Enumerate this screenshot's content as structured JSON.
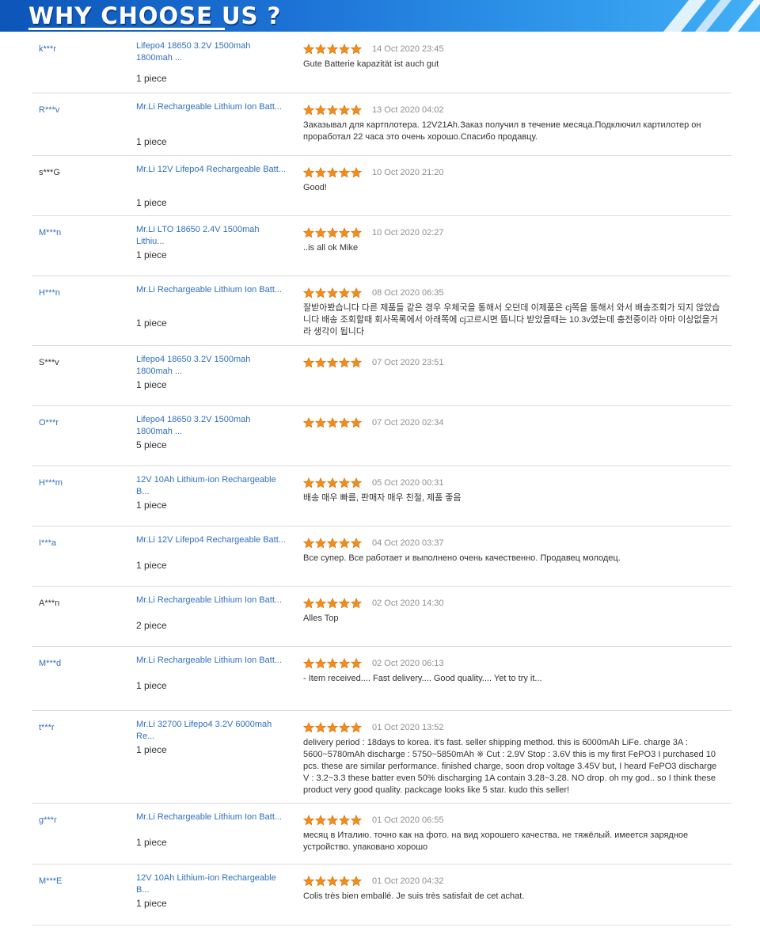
{
  "banner": {
    "title": "WHY CHOOSE US ?"
  },
  "colors": {
    "banner_blue": "#1d74d6",
    "link": "#2f6fbe",
    "star": "#f28c1c"
  },
  "star_icon": "star-icon",
  "reviews": [
    {
      "buyer": "k***r",
      "buyer_link": true,
      "product": "Lifepo4 18650 3.2V 1500mah 1800mah ...",
      "quantity": "1 piece",
      "rating": 5,
      "date": "14 Oct 2020 23:45",
      "comment": "Gute Batterie kapazität ist auch gut"
    },
    {
      "buyer": "R***v",
      "buyer_link": true,
      "product": "Mr.Li Rechargeable Lithium Ion Batt...",
      "quantity": "1 piece",
      "rating": 5,
      "date": "13 Oct 2020 04:02",
      "comment": "Заказывал для картплотера. 12V21Ah.Заказ получил в течение месяца.Подключил картилотер он проработал 22 часа это очень хорошо.Спасибо продавцу."
    },
    {
      "buyer": "s***G",
      "buyer_link": false,
      "product": "Mr.Li 12V Lifepo4 Rechargeable Batt...",
      "quantity": "1 piece",
      "rating": 5,
      "date": "10 Oct 2020 21:20",
      "comment": "Good!"
    },
    {
      "buyer": "M***n",
      "buyer_link": true,
      "product": "Mr.Li LTO 18650 2.4V 1500mah Lithiu...",
      "quantity": "1 piece",
      "rating": 5,
      "date": "10 Oct 2020 02:27",
      "comment": "..is all ok Mike"
    },
    {
      "buyer": "H***n",
      "buyer_link": true,
      "product": "Mr.Li Rechargeable Lithium Ion Batt...",
      "quantity": "1 piece",
      "rating": 5,
      "date": "08 Oct 2020 06:35",
      "comment": "잘받아봤습니다 다른 제품들 같은 경우 우체국을 통해서 오던데 이제품은 cj쪽을 통해서 와서 배송조회가 되지 않았습니다 배송 조회할때 회사목록에서 아래쪽에 cj고르시면 뜹니다 받았을때는 10.3v였는데 충전중이라 아마 이상없을거라 생각이 됩니다"
    },
    {
      "buyer": "S***v",
      "buyer_link": false,
      "product": "Lifepo4 18650 3.2V 1500mah 1800mah ...",
      "quantity": "1 piece",
      "rating": 5,
      "date": "07 Oct 2020 23:51",
      "comment": ""
    },
    {
      "buyer": "O***r",
      "buyer_link": true,
      "product": "Lifepo4 18650 3.2V 1500mah 1800mah ...",
      "quantity": "5 piece",
      "rating": 5,
      "date": "07 Oct 2020 02:34",
      "comment": ""
    },
    {
      "buyer": "H***m",
      "buyer_link": true,
      "product": "12V 10Ah Lithium-ion Rechargeable B...",
      "quantity": "1 piece",
      "rating": 5,
      "date": "05 Oct 2020 00:31",
      "comment": "배송 매우 빠름, 판매자 매우 친절, 제품 좋음"
    },
    {
      "buyer": "I***a",
      "buyer_link": true,
      "product": "Mr.Li 12V Lifepo4 Rechargeable Batt...",
      "quantity": "1 piece",
      "rating": 5,
      "date": "04 Oct 2020 03:37",
      "comment": "Все супер. Все работает и выполнено очень качественно. Продавец молодец."
    },
    {
      "buyer": "A***n",
      "buyer_link": false,
      "product": "Mr.Li Rechargeable Lithium Ion Batt...",
      "quantity": "2 piece",
      "rating": 5,
      "date": "02 Oct 2020 14:30",
      "comment": "Alles Top"
    },
    {
      "buyer": "M***d",
      "buyer_link": true,
      "product": "Mr.Li Rechargeable Lithium Ion Batt...",
      "quantity": "1 piece",
      "rating": 5,
      "date": "02 Oct 2020 06:13",
      "comment": "- Item received.... Fast delivery.... Good quality.... Yet to try it..."
    },
    {
      "buyer": "t***r",
      "buyer_link": true,
      "product": "Mr.Li 32700 Lifepo4 3.2V 6000mah Re...",
      "quantity": "1 piece",
      "rating": 5,
      "date": "01 Oct 2020 13:52",
      "comment": "delivery period : 18days to korea. it's fast. seller shipping method. this is 6000mAh LiFe. charge 3A : 5600~5780mAh discharge : 5750~5850mAh ※ Cut : 2.9V Stop : 3.6V this is my first FePO3 I purchased 10 pcs. these are similar performance. finished charge, soon drop voltage 3.45V but, I heard FePO3 discharge V : 3.2~3.3 these batter even 50% discharging 1A contain 3.28~3.28. NO drop. oh my god.. so I think these product very good quality. packcage looks like 5 star. kudo this seller!"
    },
    {
      "buyer": "g***r",
      "buyer_link": true,
      "product": "Mr.Li Rechargeable Lithium Ion Batt...",
      "quantity": "1 piece",
      "rating": 5,
      "date": "01 Oct 2020 06:55",
      "comment": "месяц в Италию. точно как на фото. на вид хорошего качества. не тяжёлый. имеется зарядное устройство. упаковано хорошо"
    },
    {
      "buyer": "M***E",
      "buyer_link": true,
      "product": "12V 10Ah Lithium-ion Rechargeable B...",
      "quantity": "1 piece",
      "rating": 5,
      "date": "01 Oct 2020 04:32",
      "comment": "Colis très bien emballé. Je suis très satisfait de cet achat."
    }
  ]
}
